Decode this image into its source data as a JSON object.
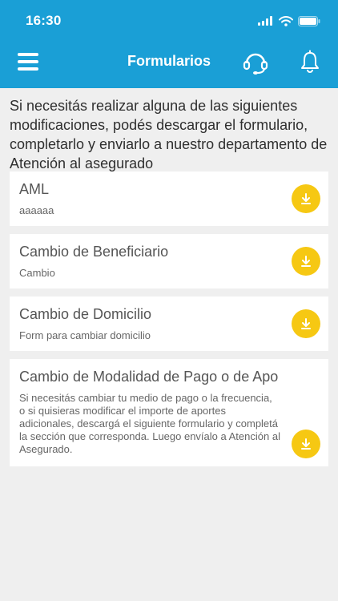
{
  "status_bar": {
    "time": "16:30"
  },
  "header": {
    "title": "Formularios"
  },
  "intro": "Si necesitás realizar alguna de las siguientes modificaciones, podés descargar el formulario, completarlo y enviarlo a nuestro departamento de Atención al asegurado",
  "forms": [
    {
      "title": "AML",
      "description": "aaaaaa"
    },
    {
      "title": "Cambio de Beneficiario",
      "description": "Cambio"
    },
    {
      "title": "Cambio de Domicilio",
      "description": "Form para cambiar domicilio"
    },
    {
      "title": "Cambio de Modalidad de Pago o de Apo",
      "description": "Si necesitás cambiar tu medio de pago o la frecuencia, o si quisieras modificar el importe de aportes adicionales, descargá el siguiente formulario y completá la sección que corresponda. Luego envíalo a Atención al Asegurado."
    }
  ],
  "colors": {
    "header": "#1a9fd6",
    "accent": "#f6c813",
    "background": "#efefef"
  },
  "icons": [
    "menu-icon",
    "support-headset-icon",
    "bell-icon",
    "download-icon",
    "signal-icon",
    "wifi-icon",
    "battery-icon"
  ]
}
